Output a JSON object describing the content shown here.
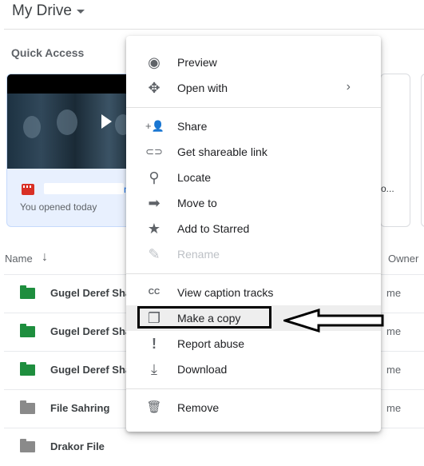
{
  "header": {
    "title": "My Drive",
    "section": "Quick Access"
  },
  "quick_access": {
    "card1": {
      "name_tail": "n",
      "subtitle": "You opened today",
      "icon": "video-file-icon"
    },
    "card2": {
      "name_tail": "o..."
    }
  },
  "list": {
    "col_name": "Name",
    "col_owner": "Owner",
    "sort_icon": "↓",
    "rows": [
      {
        "name": "Gugel Deref Shared",
        "owner": "me",
        "folder_color": "#1e8e3e"
      },
      {
        "name": "Gugel Deref Shared",
        "owner": "me",
        "folder_color": "#1e8e3e"
      },
      {
        "name": "Gugel Deref Shared",
        "owner": "me",
        "folder_color": "#1e8e3e"
      },
      {
        "name": "File Sahring",
        "owner": "me",
        "folder_color": "#8a8a8a"
      },
      {
        "name": "Drakor File",
        "owner": "",
        "folder_color": "#8a8a8a"
      }
    ]
  },
  "menu": {
    "items": [
      {
        "label": "Preview",
        "icon": "eye-icon",
        "glyph": "◉"
      },
      {
        "label": "Open with",
        "icon": "move-arrows-icon",
        "glyph": "✥",
        "submenu": "›"
      },
      {
        "label": "Share",
        "icon": "add-person-icon",
        "glyph": "+👤"
      },
      {
        "label": "Get shareable link",
        "icon": "link-icon",
        "glyph": "⊂⊃"
      },
      {
        "label": "Locate",
        "icon": "search-icon",
        "glyph": "⚲"
      },
      {
        "label": "Move to",
        "icon": "folder-move-icon",
        "glyph": "➡"
      },
      {
        "label": "Add to Starred",
        "icon": "star-icon",
        "glyph": "★"
      },
      {
        "label": "Rename",
        "icon": "pencil-icon",
        "glyph": "✎",
        "disabled": true
      },
      {
        "label": "View caption tracks",
        "icon": "caption-icon",
        "glyph": "CC"
      },
      {
        "label": "Make a copy",
        "icon": "copy-icon",
        "glyph": "❐",
        "highlight": true
      },
      {
        "label": "Report abuse",
        "icon": "alert-icon",
        "glyph": "!"
      },
      {
        "label": "Download",
        "icon": "download-icon",
        "glyph": "⤓"
      },
      {
        "label": "Remove",
        "icon": "trash-icon",
        "glyph": "🗑"
      }
    ]
  }
}
